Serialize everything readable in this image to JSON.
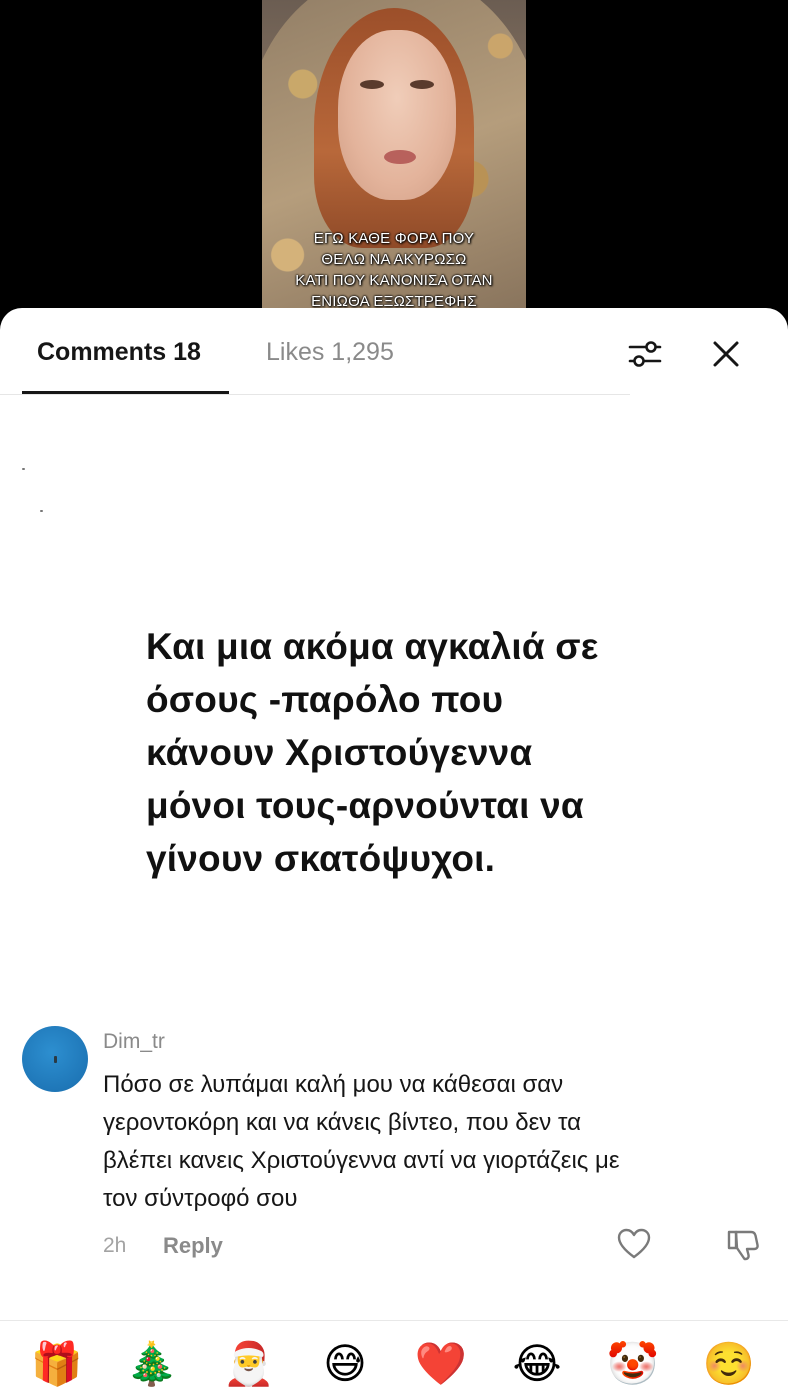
{
  "video": {
    "caption_lines": [
      "ΕΓΩ ΚΑΘΕ ΦΟΡΑ ΠΟΥ",
      "ΘΕΛΩ ΝΑ ΑΚΥΡΩΣΩ",
      "ΚΑΤΙ ΠΟΥ ΚΑΝΟΝΙΣΑ ΟΤΑΝ",
      "ΕΝΙΩΘΑ ΕΞΩΣΤΡΕΦΗΣ"
    ]
  },
  "tabs": {
    "comments_label": "Comments 18",
    "likes_label": "Likes 1,295",
    "filter_icon": "sliders-icon",
    "close_icon": "close-icon"
  },
  "quote": {
    "lines": [
      "Και μια ακόμα αγκαλιά σε",
      "όσους -παρόλο που",
      "κάνουν Χριστούγεννα",
      "μόνοι τους-αρνούνται να",
      "γίνουν σκατόψυχοι."
    ]
  },
  "comment": {
    "username": "Dim_tr",
    "text_lines": [
      "Πόσο σε λυπάμαι καλή μου να κάθεσαι σαν",
      "γεροντοκόρη και να κάνεις βίντεο, που δεν τα",
      "βλέπει κανεις Χριστούγεννα αντί να γιορτάζεις με",
      "τον σύντροφό σου"
    ],
    "time": "2h",
    "reply_label": "Reply",
    "avatar_color": "#1f77b8"
  },
  "emoji_bar": {
    "items": [
      {
        "name": "gift-emoji",
        "glyph": "🎁"
      },
      {
        "name": "christmas-tree-emoji",
        "glyph": "🎄"
      },
      {
        "name": "santa-emoji",
        "glyph": "🎅"
      },
      {
        "name": "grinning-sweat-emoji",
        "glyph": "😅"
      },
      {
        "name": "red-heart-emoji",
        "glyph": "❤️"
      },
      {
        "name": "tears-of-joy-emoji",
        "glyph": "😂"
      },
      {
        "name": "clown-emoji",
        "glyph": "🤡"
      },
      {
        "name": "smiling-emoji",
        "glyph": "☺️"
      }
    ]
  }
}
